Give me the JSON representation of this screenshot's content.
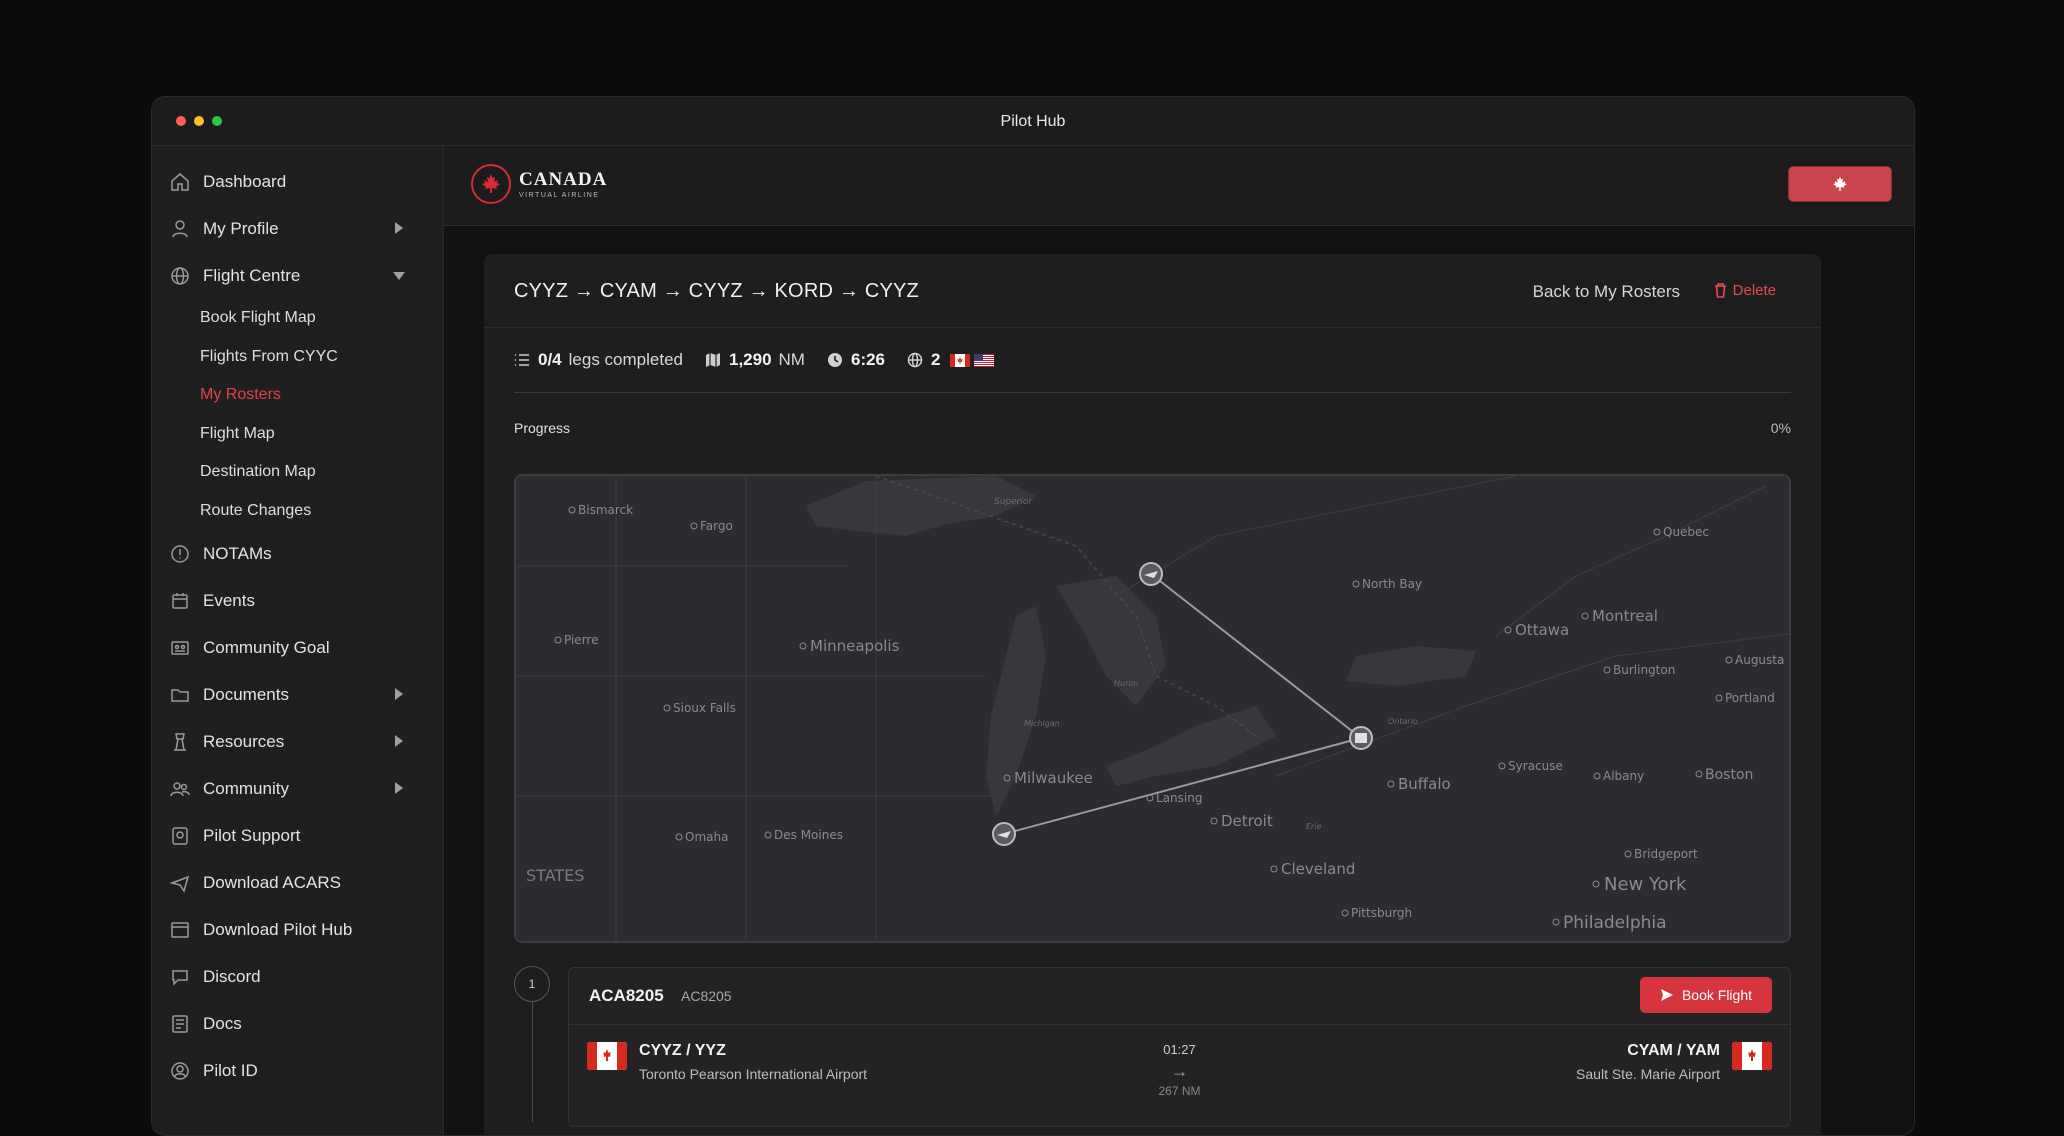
{
  "window": {
    "title": "Pilot Hub"
  },
  "sidebar": {
    "items": [
      {
        "label": "Dashboard",
        "icon": "home-icon"
      },
      {
        "label": "My Profile",
        "icon": "profile-icon",
        "caret": "right"
      },
      {
        "label": "Flight Centre",
        "icon": "globe-icon",
        "caret": "down"
      },
      {
        "label": "NOTAMs",
        "icon": "alert-icon"
      },
      {
        "label": "Events",
        "icon": "calendar-icon"
      },
      {
        "label": "Community Goal",
        "icon": "goal-icon"
      },
      {
        "label": "Documents",
        "icon": "folder-icon",
        "caret": "right"
      },
      {
        "label": "Resources",
        "icon": "tower-icon",
        "caret": "right"
      },
      {
        "label": "Community",
        "icon": "people-icon",
        "caret": "right"
      },
      {
        "label": "Pilot Support",
        "icon": "support-icon"
      },
      {
        "label": "Download ACARS",
        "icon": "plane-icon"
      },
      {
        "label": "Download Pilot Hub",
        "icon": "window-icon"
      },
      {
        "label": "Discord",
        "icon": "chat-icon"
      },
      {
        "label": "Docs",
        "icon": "book-icon"
      },
      {
        "label": "Pilot ID",
        "icon": "user-circle-icon"
      }
    ],
    "flight_centre_sub": [
      "Book Flight Map",
      "Flights From CYYC",
      "My Rosters",
      "Flight Map",
      "Destination Map",
      "Route Changes"
    ],
    "active_sub": "My Rosters"
  },
  "brand": {
    "name": "CANADA",
    "tagline": "VIRTUAL AIRLINE",
    "accent": "#d6353e"
  },
  "roster": {
    "title": "CYYZ → CYAM → CYYZ → KORD → CYYZ",
    "back_label": "Back to My Rosters",
    "delete_label": "Delete",
    "legs_completed": "0/4",
    "legs_label": "legs completed",
    "distance_value": "1,290",
    "distance_unit": "NM",
    "duration": "6:26",
    "countries_count": "2",
    "progress_label": "Progress",
    "progress_pct": "0%",
    "progress_value": 0
  },
  "map": {
    "cities": [
      "Bismarck",
      "Fargo",
      "Superior",
      "Quebec",
      "North Bay",
      "Pierre",
      "Minneapolis",
      "Montreal",
      "Ottawa",
      "Augusta",
      "Burlington",
      "Portland",
      "Sioux Falls",
      "Michigan",
      "Huron",
      "Ontario",
      "Milwaukee",
      "Lansing",
      "Buffalo",
      "Syracuse",
      "Albany",
      "Boston",
      "Omaha",
      "Des Moines",
      "Detroit",
      "Erie",
      "Bridgeport",
      "STATES",
      "Cleveland",
      "New York",
      "Pittsburgh",
      "Philadelphia"
    ]
  },
  "leg": {
    "number": "1",
    "callsign": "ACA8205",
    "flight_no": "AC8205",
    "book_label": "Book Flight",
    "time": "01:27",
    "distance": "267 NM",
    "origin": {
      "code": "CYYZ / YYZ",
      "name": "Toronto Pearson International Airport"
    },
    "destination": {
      "code": "CYAM / YAM",
      "name": "Sault Ste. Marie Airport"
    }
  }
}
